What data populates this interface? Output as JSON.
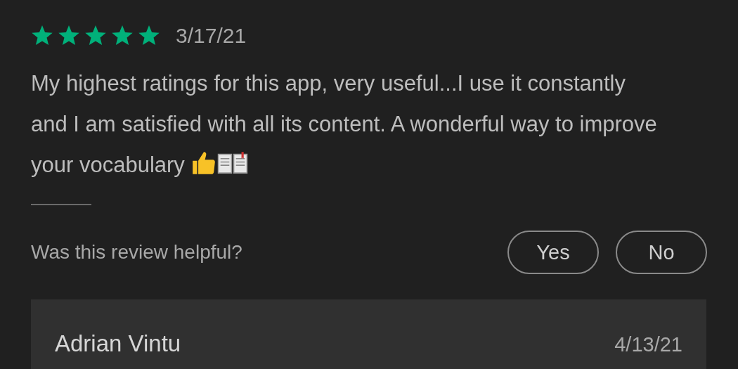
{
  "review": {
    "stars": 5,
    "date": "3/17/21",
    "text": "My highest ratings for this app, very useful...I use it constantly and I am satisfied with all its content. A wonderful way to improve your vocabulary"
  },
  "helpful": {
    "question": "Was this review helpful?",
    "buttons": [
      "Yes",
      "No"
    ]
  },
  "reply": {
    "author": "Adrian Vintu",
    "date": "4/13/21"
  }
}
